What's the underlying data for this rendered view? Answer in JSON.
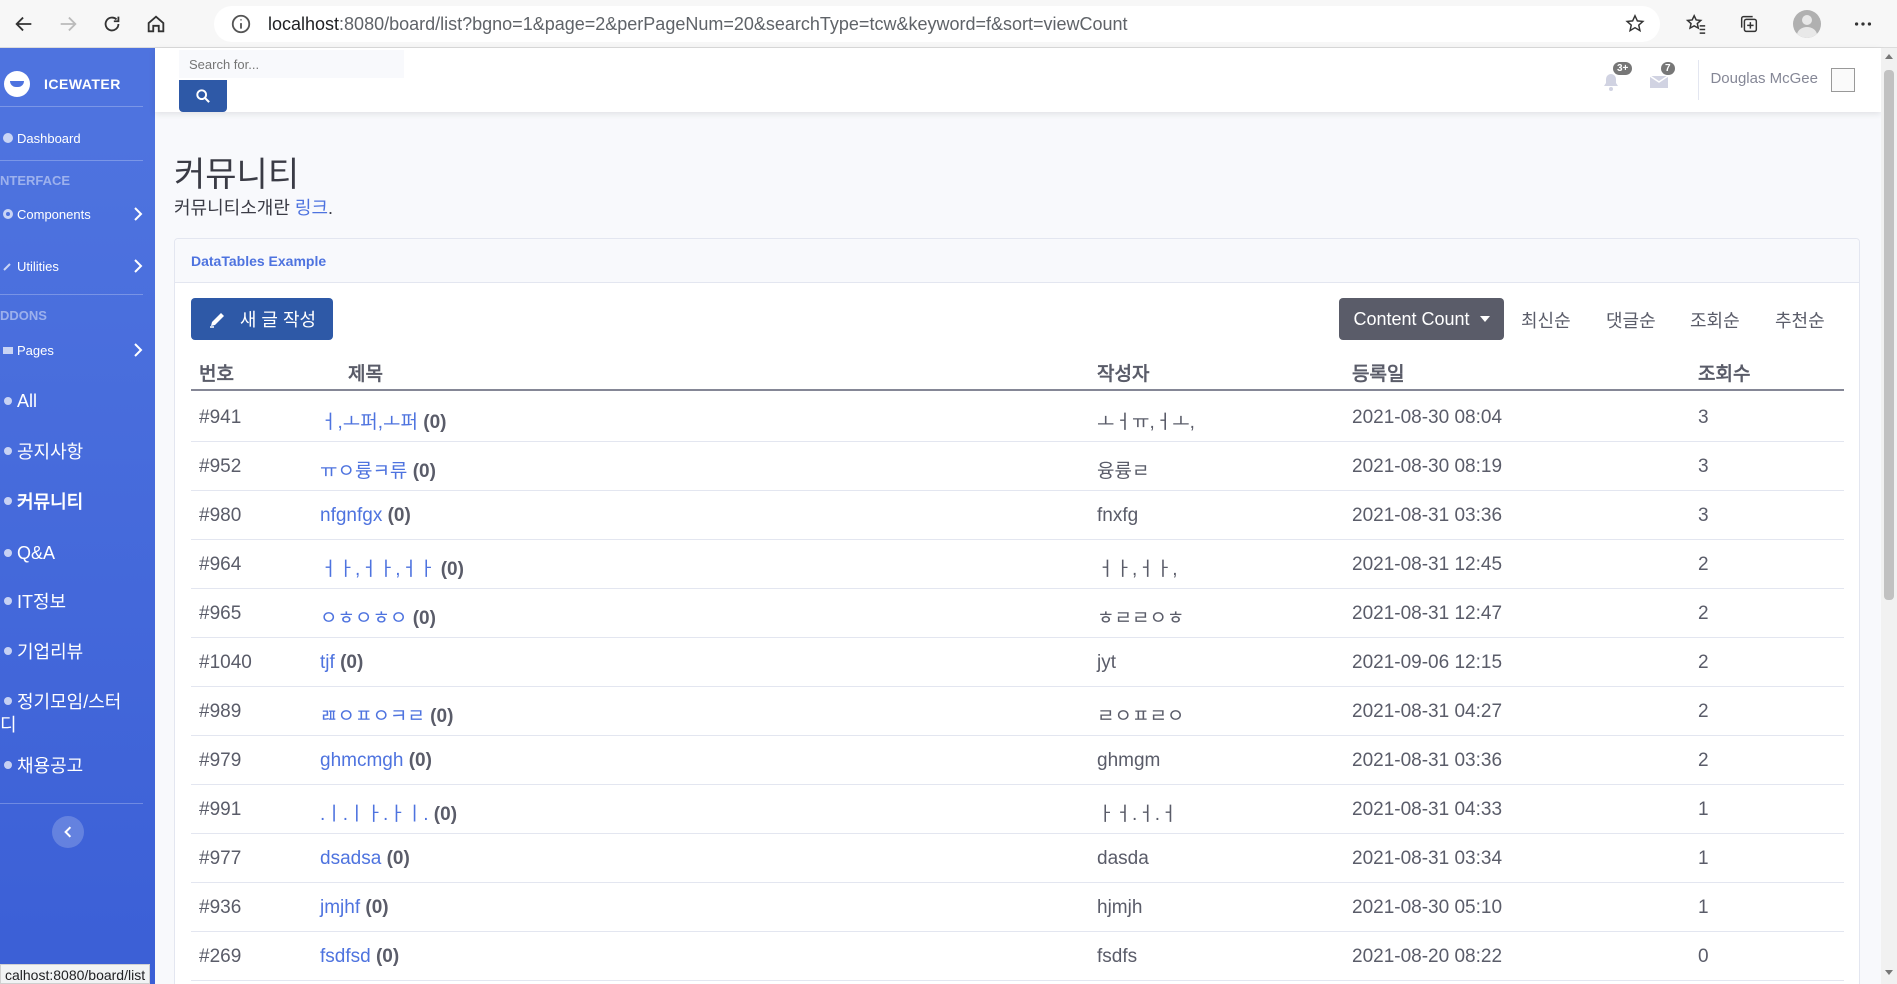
{
  "browser": {
    "url_host": "localhost",
    "url_rest": ":8080/board/list?bgno=1&page=2&perPageNum=20&searchType=tcw&keyword=f&sort=viewCount",
    "status_url": "calhost:8080/board/list"
  },
  "sidebar": {
    "brand": "ICEWATER",
    "dashboard": "Dashboard",
    "heading_interface": "NTERFACE",
    "components": "Components",
    "utilities": "Utilities",
    "heading_addons": "DDONS",
    "pages": "Pages",
    "items": [
      {
        "label": "All"
      },
      {
        "label": "공지사항"
      },
      {
        "label": "커뮤니티"
      },
      {
        "label": "Q&A"
      },
      {
        "label": "IT정보"
      },
      {
        "label": "기업리뷰"
      },
      {
        "label": "정기모임/스터"
      },
      {
        "label": "디"
      },
      {
        "label": "채용공고"
      }
    ]
  },
  "topbar": {
    "search_placeholder": "Search for...",
    "alerts_badge": "3+",
    "messages_badge": "7",
    "user_name": "Douglas McGee"
  },
  "page": {
    "title": "커뮤니티",
    "desc_prefix": "커뮤니티소개란 ",
    "desc_link": "링크",
    "desc_suffix": "."
  },
  "card": {
    "header": "DataTables Example",
    "write_button": "새 글 작성",
    "count_button": "Content Count",
    "sort_links": [
      "최신순",
      "댓글순",
      "조회순",
      "추천순"
    ]
  },
  "table": {
    "columns": [
      "번호",
      "제목",
      "작성자",
      "등록일",
      "조회수"
    ],
    "rows": [
      {
        "no": "#941",
        "title": "ㅓ,ㅗ퍼,ㅗ퍼",
        "comments": "(0)",
        "author": "ㅗㅓㅠ,ㅓㅗ,",
        "date": "2021-08-30 08:04",
        "views": "3"
      },
      {
        "no": "#952",
        "title": "ㅠㅇ륭ㅋ류",
        "comments": "(0)",
        "author": "융륭ㄹ",
        "date": "2021-08-30 08:19",
        "views": "3"
      },
      {
        "no": "#980",
        "title": "nfgnfgx",
        "comments": "(0)",
        "author": "fnxfg",
        "date": "2021-08-31 03:36",
        "views": "3"
      },
      {
        "no": "#964",
        "title": "ㅓㅏ,ㅓㅏ,ㅓㅏ",
        "comments": "(0)",
        "author": "ㅓㅏ,ㅓㅏ,",
        "date": "2021-08-31 12:45",
        "views": "2"
      },
      {
        "no": "#965",
        "title": "ㅇㅎㅇㅎㅇ",
        "comments": "(0)",
        "author": "ㅎㄹㄹㅇㅎ",
        "date": "2021-08-31 12:47",
        "views": "2"
      },
      {
        "no": "#1040",
        "title": "tjf",
        "comments": "(0)",
        "author": "jyt",
        "date": "2021-09-06 12:15",
        "views": "2"
      },
      {
        "no": "#989",
        "title": "ㄿㅇㅍㅇㅋㄹ",
        "comments": "(0)",
        "author": "ㄹㅇㅍㄹㅇ",
        "date": "2021-08-31 04:27",
        "views": "2"
      },
      {
        "no": "#979",
        "title": "ghmcmgh",
        "comments": "(0)",
        "author": "ghmgm",
        "date": "2021-08-31 03:36",
        "views": "2"
      },
      {
        "no": "#991",
        "title": ".ㅣ.ㅣㅏ.ㅏㅣ.",
        "comments": "(0)",
        "author": "ㅏㅓ.ㅓ.ㅓ",
        "date": "2021-08-31 04:33",
        "views": "1"
      },
      {
        "no": "#977",
        "title": "dsadsa",
        "comments": "(0)",
        "author": "dasda",
        "date": "2021-08-31 03:34",
        "views": "1"
      },
      {
        "no": "#936",
        "title": "jmjhf",
        "comments": "(0)",
        "author": "hjmjh",
        "date": "2021-08-30 05:10",
        "views": "1"
      },
      {
        "no": "#269",
        "title": "fsdfsd",
        "comments": "(0)",
        "author": "fsdfs",
        "date": "2021-08-20 08:22",
        "views": "0"
      }
    ]
  }
}
